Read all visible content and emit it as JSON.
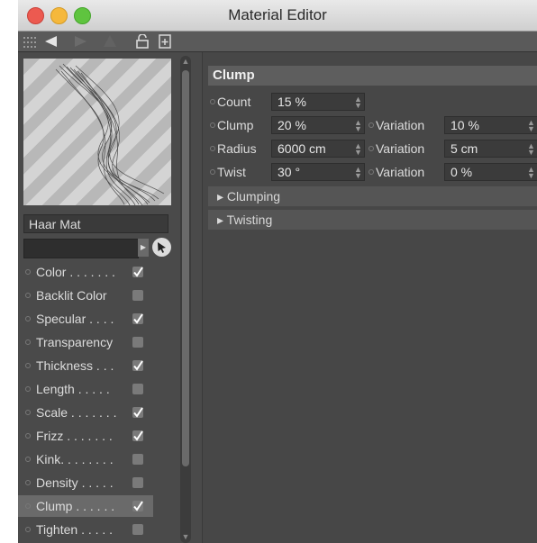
{
  "window": {
    "title": "Material Editor",
    "traffic_lights": [
      "#ec5a50",
      "#f5b83c",
      "#5fc43f"
    ]
  },
  "toolbar": {
    "icons": [
      "grid-icon",
      "back-arrow-icon",
      "forward-arrow-icon",
      "up-arrow-icon",
      "lock-icon",
      "new-window-icon"
    ]
  },
  "material": {
    "name": "Haar Mat",
    "search_value": ""
  },
  "channels": [
    {
      "label": "Color . . . . . . .",
      "checked": true
    },
    {
      "label": "Backlit Color",
      "checked": false
    },
    {
      "label": "Specular . . . .",
      "checked": true
    },
    {
      "label": "Transparency",
      "checked": false
    },
    {
      "label": "Thickness . . .",
      "checked": true
    },
    {
      "label": "Length . . . . .",
      "checked": false
    },
    {
      "label": "Scale . . . . . . .",
      "checked": true
    },
    {
      "label": "Frizz . . . . . . .",
      "checked": true
    },
    {
      "label": "Kink. . . . . . . .",
      "checked": false
    },
    {
      "label": "Density . . . . .",
      "checked": false
    },
    {
      "label": "Clump . . . . . .",
      "checked": true,
      "selected": true
    },
    {
      "label": "Tighten . . . . .",
      "checked": false
    }
  ],
  "clump": {
    "header": "Clump",
    "count": {
      "label": "Count",
      "value": "15 %"
    },
    "clump": {
      "label": "Clump",
      "value": "20 %",
      "var_label": "Variation",
      "var_value": "10 %"
    },
    "radius": {
      "label": "Radius",
      "value": "6000 cm",
      "var_label": "Variation",
      "var_value": "5 cm"
    },
    "twist": {
      "label": "Twist",
      "value": "30 °",
      "var_label": "Variation",
      "var_value": "0 %"
    },
    "sections": [
      "▸ Clumping",
      "▸ Twisting"
    ]
  }
}
